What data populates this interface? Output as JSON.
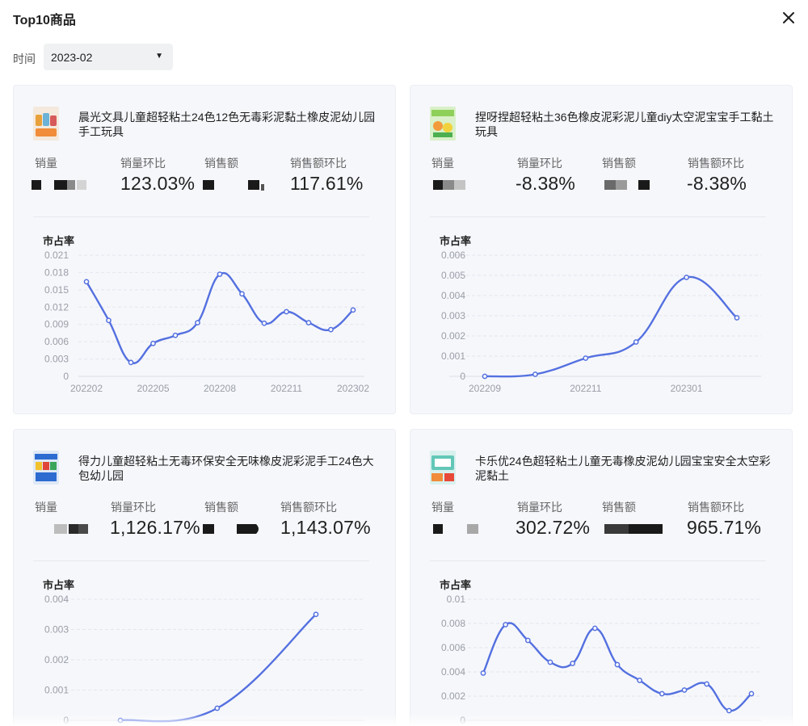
{
  "dialog": {
    "title": "Top10商品",
    "close_icon": "close-icon"
  },
  "filter": {
    "label": "时间",
    "value": "2023-02",
    "caret": "▼"
  },
  "metric_labels": [
    "销量",
    "销量环比",
    "销售额",
    "销售额环比"
  ],
  "chart_label": "市占率",
  "accent_color": "#5470e0",
  "cards": [
    {
      "name": "晨光文具儿童超轻粘土24色12色无毒彩泥黏土橡皮泥幼儿园手工玩具",
      "sales_mom": "123.03%",
      "revenue_mom": "117.61%"
    },
    {
      "name": "捏呀捏超轻粘土36色橡皮泥彩泥儿童diy太空泥宝宝手工黏土玩具",
      "sales_mom": "-8.38%",
      "revenue_mom": "-8.38%"
    },
    {
      "name": "得力儿童超轻粘土无毒环保安全无味橡皮泥彩泥手工24色大包幼儿园",
      "sales_mom": "1,126.17%",
      "revenue_mom": "1,143.07%"
    },
    {
      "name": "卡乐优24色超轻粘土儿童无毒橡皮泥幼儿园宝宝安全太空彩泥黏土",
      "sales_mom": "302.72%",
      "revenue_mom": "965.71%"
    }
  ],
  "chart_data": [
    {
      "type": "line",
      "title": "市占率",
      "ylabel": "市占率",
      "ylim": [
        0,
        0.021
      ],
      "yticks": [
        "0",
        "0.003",
        "0.006",
        "0.009",
        "0.012",
        "0.015",
        "0.018",
        "0.021"
      ],
      "xticks": [
        "202202",
        "202205",
        "202208",
        "202211",
        "202302"
      ],
      "x": [
        "202202",
        "202203",
        "202204",
        "202205",
        "202206",
        "202207",
        "202208",
        "202209",
        "202210",
        "202211",
        "202212",
        "202301",
        "202302"
      ],
      "values": [
        0.0164,
        0.0097,
        0.0024,
        0.0057,
        0.0071,
        0.0093,
        0.0177,
        0.0143,
        0.0092,
        0.0112,
        0.0093,
        0.0081,
        0.0115
      ],
      "grid": true
    },
    {
      "type": "line",
      "title": "市占率",
      "ylabel": "市占率",
      "ylim": [
        0,
        0.006
      ],
      "yticks": [
        "0",
        "0.001",
        "0.002",
        "0.003",
        "0.004",
        "0.005",
        "0.006"
      ],
      "xticks": [
        "202209",
        "202211",
        "202301"
      ],
      "x": [
        "202209",
        "202210",
        "202211",
        "202212",
        "202301",
        "202302"
      ],
      "values": [
        0.0,
        0.0001,
        0.0009,
        0.0017,
        0.0049,
        0.0029
      ],
      "grid": true
    },
    {
      "type": "line",
      "title": "市占率",
      "ylabel": "市占率",
      "ylim": [
        0,
        0.004
      ],
      "yticks": [
        "0",
        "0.001",
        "0.002",
        "0.003",
        "0.004"
      ],
      "xticks": [],
      "x": [
        "202212",
        "202301",
        "202302"
      ],
      "values": [
        0.0,
        0.0004,
        0.0035
      ],
      "grid": true
    },
    {
      "type": "line",
      "title": "市占率",
      "ylabel": "市占率",
      "ylim": [
        0,
        0.01
      ],
      "yticks": [
        "0",
        "0.002",
        "0.004",
        "0.006",
        "0.008",
        "0.01"
      ],
      "xticks": [],
      "x": [
        "202202",
        "202203",
        "202204",
        "202205",
        "202206",
        "202207",
        "202208",
        "202209",
        "202210",
        "202211",
        "202212",
        "202301",
        "202302"
      ],
      "values": [
        0.0039,
        0.0079,
        0.0066,
        0.0048,
        0.0047,
        0.0076,
        0.0046,
        0.0033,
        0.0022,
        0.0025,
        0.003,
        0.0008,
        0.0022
      ],
      "grid": true
    }
  ]
}
